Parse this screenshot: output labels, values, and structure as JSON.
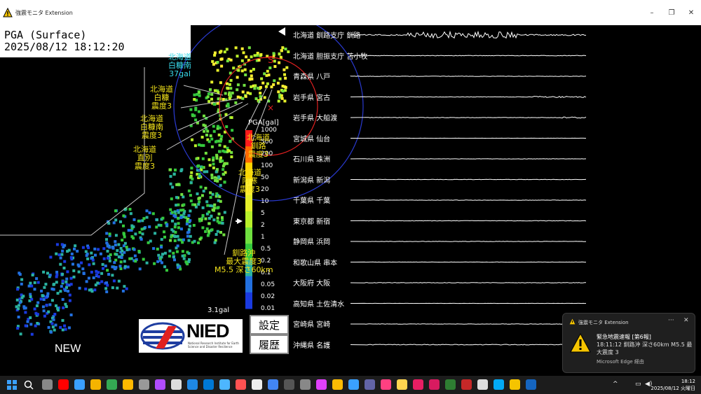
{
  "window": {
    "title": "強震モニタ Extension",
    "controls": [
      "–",
      "❐",
      "✕"
    ]
  },
  "monitor": {
    "pga_title": "PGA (Surface)",
    "timestamp": "2025/08/12 18:12:20",
    "scale_title": "PGA[gal]",
    "scale_ticks": [
      "1000",
      "500",
      "200",
      "100",
      "50",
      "20",
      "10",
      "5",
      "2",
      "1",
      "0.5",
      "0.2",
      "0.1",
      "0.05",
      "0.02",
      "0.01"
    ],
    "left_value_label": "3.1gal",
    "s_wave_mark": "S",
    "new_label": "NEW",
    "settings_button": "設定",
    "history_button": "履歴",
    "nied_logo": "NIED",
    "nied_subtitle": "National Research Institute for Earth Science and Disaster Resilience",
    "annotations": [
      {
        "label": "北海道\n白糠南\n37gal",
        "color": "#38d8e8"
      },
      {
        "label": "北海道\n白糠\n震度3",
        "color": "#f2e21a"
      },
      {
        "label": "北海道\n白糠南\n震度3",
        "color": "#f2e21a"
      },
      {
        "label": "北海道\n直別\n震度3",
        "color": "#f2e21a"
      },
      {
        "label": "北海道\n釧路\n震度3",
        "color": "#f2e21a"
      },
      {
        "label": "北海道\n阿寒\n震度3",
        "color": "#f2e21a"
      },
      {
        "label": "釧路沖\n最大震度3\nM5.5 深さ60km",
        "color": "#f2e21a"
      }
    ]
  },
  "waveforms": [
    {
      "station": "北海道 釧路支庁 釧路",
      "activity": 0.9
    },
    {
      "station": "北海道 胆振支庁 苫小牧",
      "activity": 0.4
    },
    {
      "station": "青森県 八戸",
      "activity": 0.3
    },
    {
      "station": "岩手県 宮古",
      "activity": 0.35
    },
    {
      "station": "岩手県 大船渡",
      "activity": 0.3
    },
    {
      "station": "宮城県 仙台",
      "activity": 0.15
    },
    {
      "station": "石川県 珠洲",
      "activity": 0.2
    },
    {
      "station": "新潟県 新潟",
      "activity": 0.25
    },
    {
      "station": "千葉県 千葉",
      "activity": 0.2
    },
    {
      "station": "東京都 新宿",
      "activity": 0.3
    },
    {
      "station": "静岡県 浜岡",
      "activity": 0.25
    },
    {
      "station": "和歌山県 串本",
      "activity": 0.2
    },
    {
      "station": "大阪府 大阪",
      "activity": 0.35
    },
    {
      "station": "高知県 土佐清水",
      "activity": 0.15
    },
    {
      "station": "宮崎県 宮崎",
      "activity": 0.3
    },
    {
      "station": "沖縄県 名護",
      "activity": 0.5
    }
  ],
  "toast": {
    "app": "強震モニタ Extension",
    "more": "···",
    "close": "✕",
    "title": "緊急地震速報 [第6報]",
    "body": "18:11:12 釧路沖 深さ60km M5.5 最大震度 3",
    "via": "Microsoft Edge 経由"
  },
  "taskbar": {
    "time": "18:12",
    "date": "2025/08/12 火曜日",
    "badge": "9"
  },
  "colors": {
    "scale": [
      "#ff1a1a",
      "#ff6a00",
      "#ffd400",
      "#ffee33",
      "#e6f02a",
      "#b8f02a",
      "#70e040",
      "#34c83c",
      "#2ab2a0",
      "#2270e0",
      "#1a3ae0"
    ]
  }
}
